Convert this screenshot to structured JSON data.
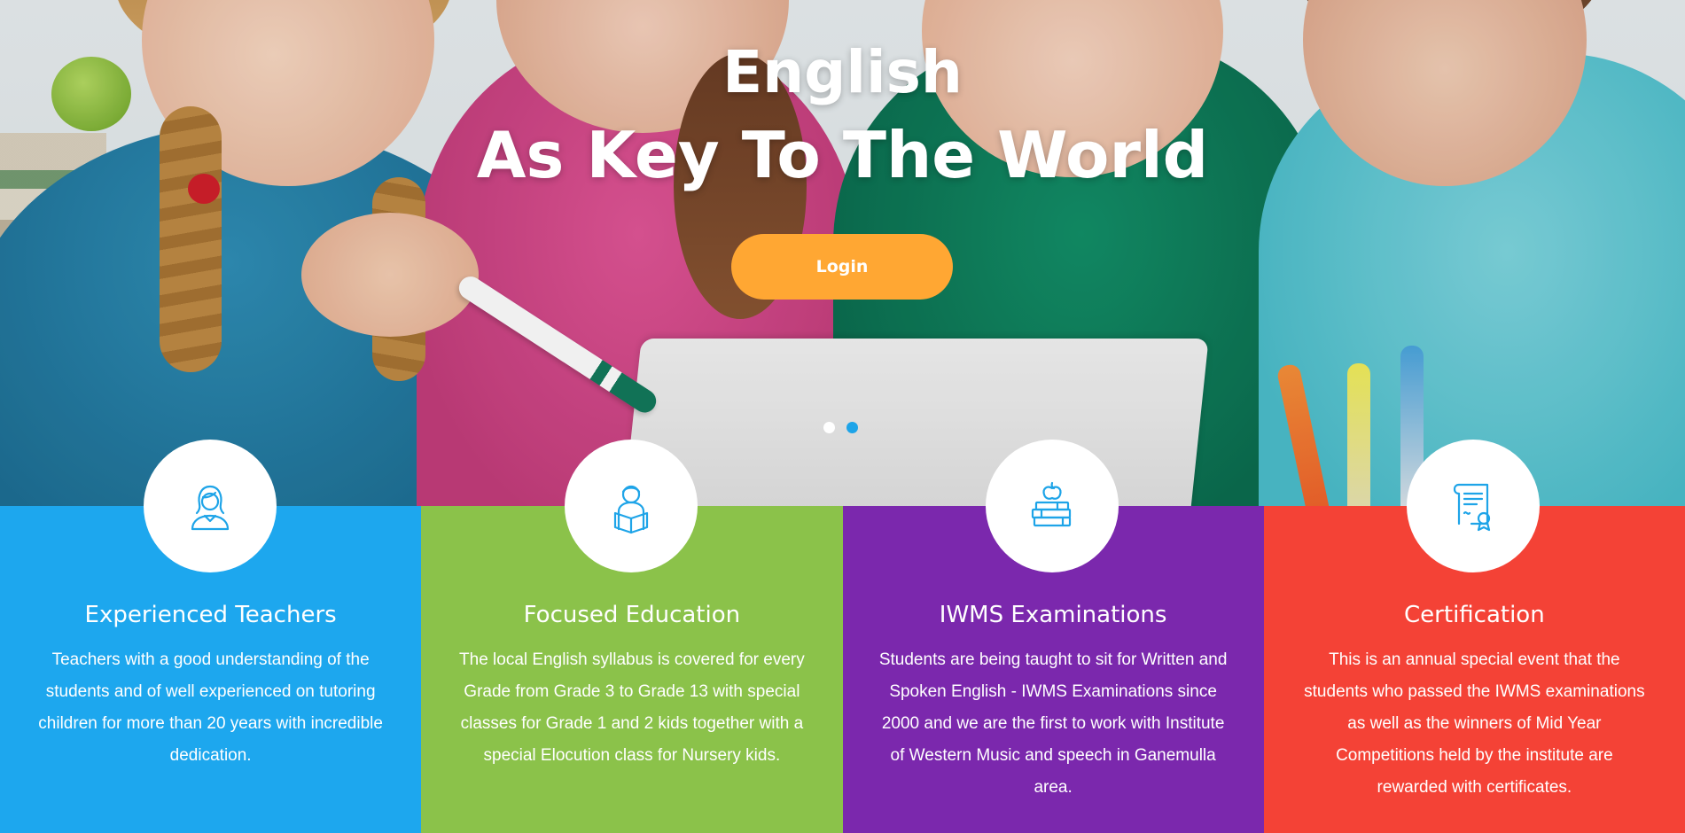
{
  "hero": {
    "title_line1": "English",
    "title_line2": "As Key To The World",
    "login_label": "Login",
    "slides": 2,
    "active_slide": 2
  },
  "features": [
    {
      "icon": "teacher-icon",
      "color": "#1da7ee",
      "title": "Experienced Teachers",
      "text": "Teachers with a good understanding of the students and of well experienced on tutoring children for more than 20 years with incredible dedication."
    },
    {
      "icon": "student-reading-icon",
      "color": "#8bc24a",
      "title": "Focused Education",
      "text": "The local English syllabus is covered for every Grade from Grade 3 to Grade 13 with special classes for Grade 1 and 2 kids together with a special Elocution class for Nursery kids."
    },
    {
      "icon": "books-apple-icon",
      "color": "#7b28ad",
      "title": "IWMS Examinations",
      "text": "Students are being taught to sit for Written and Spoken English - IWMS Examinations since 2000 and we are the first to work with Institute of Western Music and speech in Ganemulla area."
    },
    {
      "icon": "certificate-icon",
      "color": "#f44236",
      "title": "Certification",
      "text": "This is an annual special event that the students who passed the IWMS examinations as well as the winners of Mid Year Competitions held by the institute are rewarded with certificates."
    }
  ],
  "colors": {
    "accent_orange": "#ffa733",
    "icon_blue": "#1ea4e8"
  }
}
